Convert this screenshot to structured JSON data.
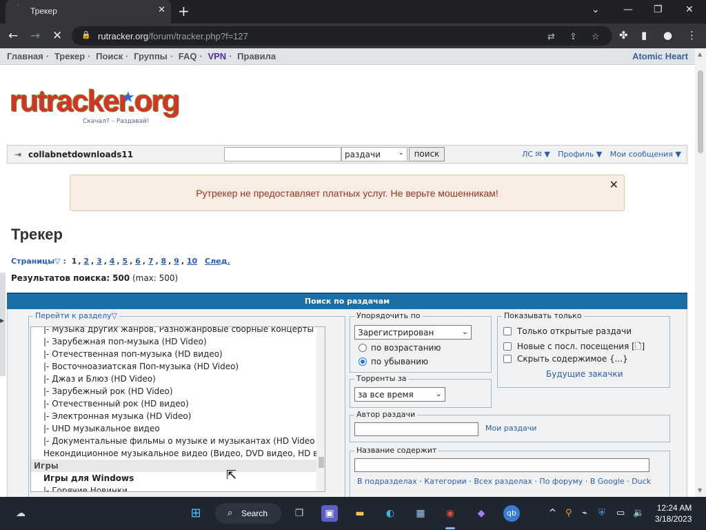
{
  "browser": {
    "tab_title": "Трекер",
    "url_domain": "rutracker.org",
    "url_path": "/forum/tracker.php?f=127"
  },
  "topnav": {
    "items": [
      "Главная",
      "Трекер",
      "Поиск",
      "Группы",
      "FAQ",
      "VPN",
      "Правила"
    ],
    "promo": "Atomic Heart"
  },
  "logo": {
    "text": "rutracker.org",
    "tagline": "Скачал? – Раздавай!"
  },
  "userbar": {
    "username": "collabnetdownloads11",
    "search_scope": "раздачи",
    "search_button": "поиск",
    "messages": "ЛС ✉ ▼",
    "profile": "Профиль ▼",
    "my_messages": "Мои сообщения ▼"
  },
  "notice": {
    "text": "Рутрекер не предоставляет платных услуг. Не верьте мошенникам!"
  },
  "page": {
    "title": "Трекер",
    "pages_label": "Страницы▽ :",
    "current_page": "1",
    "page_links": [
      "2",
      "3",
      "4",
      "5",
      "6",
      "7",
      "8",
      "9",
      "10"
    ],
    "next": "След.",
    "results_label": "Результатов поиска:",
    "results_count": "500",
    "results_max": "(max: 500)"
  },
  "search": {
    "header": "Поиск по раздачам",
    "forum_legend": "Перейти к разделу▽",
    "forum_rows": [
      {
        "text": "|- Музыка других жанров, Разножанровые сборные концерты",
        "kind": "item"
      },
      {
        "text": "|- Зарубежная поп-музыка (HD Video)",
        "kind": "item"
      },
      {
        "text": "|- Отечественная поп-музыка (HD видео)",
        "kind": "item"
      },
      {
        "text": "|- Восточноазиатская Поп-музыка (HD Video)",
        "kind": "item"
      },
      {
        "text": "|- Джаз и Блюз (HD Video)",
        "kind": "item"
      },
      {
        "text": "|- Зарубежный рок (HD Video)",
        "kind": "item"
      },
      {
        "text": "|- Отечественный рок (HD видео)",
        "kind": "item"
      },
      {
        "text": "|- Электронная музыка (HD Video)",
        "kind": "item"
      },
      {
        "text": "|- UHD музыкальное видео",
        "kind": "item"
      },
      {
        "text": "|- Документальные фильмы о музыке и музыкантах (HD Video",
        "kind": "item"
      },
      {
        "text": "Некондиционное музыкальное видео (Видео, DVD видео, HD в",
        "kind": "item"
      },
      {
        "text": "Игры",
        "kind": "cat"
      },
      {
        "text": "Игры для Windows",
        "kind": "sub"
      },
      {
        "text": "|- Горячие Новинки",
        "kind": "item"
      }
    ],
    "sort_legend": "Упорядочить по",
    "sort_value": "Зарегистрирован",
    "sort_asc": "по возрастанию",
    "sort_desc": "по убыванию",
    "period_legend": "Торренты за",
    "period_value": "за все время",
    "show_legend": "Показывать только",
    "show_open": "Только открытые раздачи",
    "show_new": "Новые с посл. посещения",
    "show_new_mark": "[🗋]",
    "show_hide": "Скрыть содержимое {...}",
    "future_downloads": "Будущие закачки",
    "author_legend": "Автор раздачи",
    "my_releases": "Мои раздачи",
    "title_legend": "Название содержит",
    "scope_links": [
      "В подразделах",
      "Категории",
      "Всех разделах",
      "По форуму",
      "В Google",
      "Duck"
    ]
  },
  "taskbar": {
    "search_label": "Search",
    "time": "12:24 AM",
    "date": "3/18/2023"
  }
}
